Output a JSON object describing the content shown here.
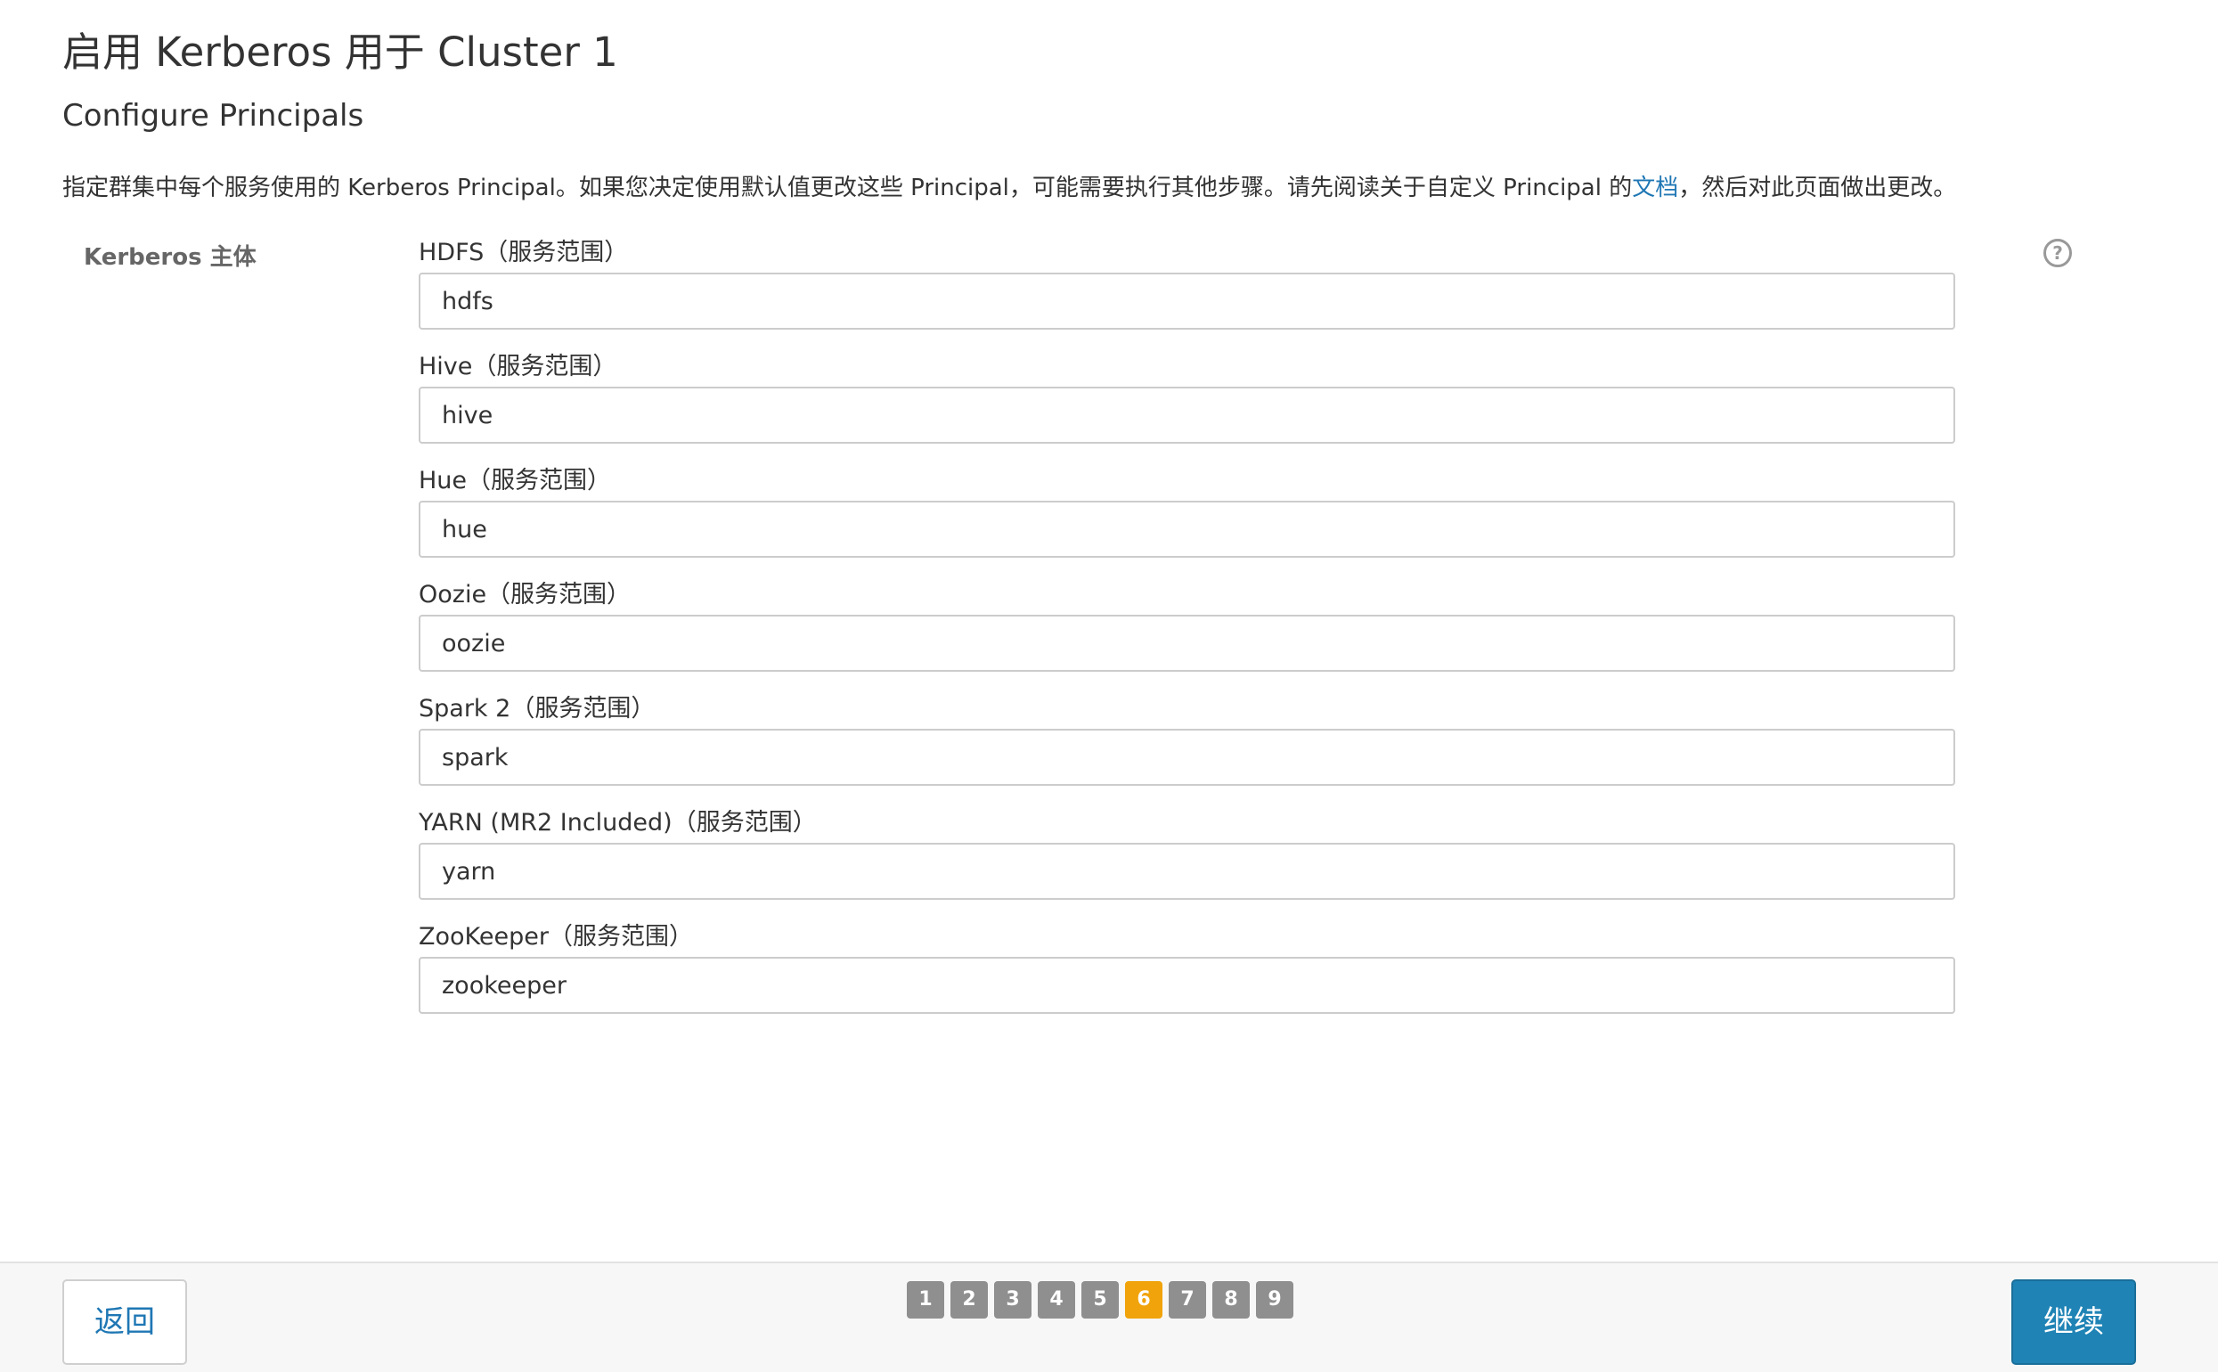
{
  "header": {
    "title": "启用 Kerberos 用于 Cluster 1",
    "subtitle": "Configure Principals"
  },
  "description": {
    "text_before": "指定群集中每个服务使用的 Kerberos Principal。如果您决定使用默认值更改这些 Principal，可能需要执行其他步骤。请先阅读关于自定义 Principal 的",
    "link": "文档",
    "text_after": "，然后对此页面做出更改。"
  },
  "form": {
    "row_label": "Kerberos 主体",
    "help_icon": "?",
    "fields": [
      {
        "label": "HDFS（服务范围）",
        "value": "hdfs"
      },
      {
        "label": "Hive（服务范围）",
        "value": "hive"
      },
      {
        "label": "Hue（服务范围）",
        "value": "hue"
      },
      {
        "label": "Oozie（服务范围）",
        "value": "oozie"
      },
      {
        "label": "Spark 2（服务范围）",
        "value": "spark"
      },
      {
        "label": "YARN (MR2 Included)（服务范围）",
        "value": "yarn"
      },
      {
        "label": "ZooKeeper（服务范围）",
        "value": "zookeeper"
      }
    ]
  },
  "footer": {
    "back_label": "返回",
    "continue_label": "继续",
    "steps": [
      "1",
      "2",
      "3",
      "4",
      "5",
      "6",
      "7",
      "8",
      "9"
    ],
    "active_step": "6"
  },
  "colors": {
    "link": "#1f77b4",
    "primary_button": "#1f83b5",
    "active_step": "#f0a30a",
    "inactive_step": "#8f8f8f"
  }
}
